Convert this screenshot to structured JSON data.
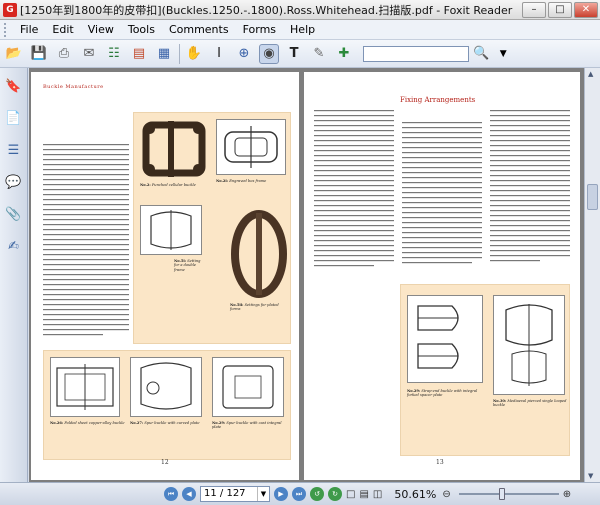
{
  "window": {
    "title": "[1250年到1800年的皮带扣](Buckles.1250.-.1800).Ross.Whitehead.扫描版.pdf - Foxit Reader",
    "controls": [
      "minimize",
      "maximize",
      "close"
    ]
  },
  "menu": {
    "items": [
      "File",
      "Edit",
      "View",
      "Tools",
      "Comments",
      "Forms",
      "Help"
    ]
  },
  "toolbar": {
    "icons": [
      "open-folder-icon",
      "save-icon",
      "print-icon",
      "email-icon",
      "export-icon",
      "scan-icon",
      "snapshot-icon",
      "hand-icon",
      "select-text-icon",
      "zoom-in-icon",
      "snapshot-camera-icon",
      "text-tool-icon",
      "pencil-icon",
      "eraser-icon",
      "search-icon"
    ]
  },
  "left_panel": {
    "icons": [
      "bookmarks-icon",
      "pages-icon",
      "layers-icon",
      "comments-icon",
      "attachments-icon",
      "signatures-icon"
    ]
  },
  "document": {
    "left_page": {
      "running_head": "Buckle Manufacture",
      "page_number": "12",
      "captions": [
        {
          "no": "No.2:",
          "text": "Punched cellular buckle"
        },
        {
          "no": "No.2i:",
          "text": "Engraved box frame"
        },
        {
          "no": "No.5i:",
          "text": "Setting for a double frame"
        },
        {
          "no": "No.5ii:",
          "text": "Settings for plated forms"
        },
        {
          "no": "No.26:",
          "text": "Folded sheet copper-alloy buckle"
        },
        {
          "no": "No.27:",
          "text": "Spur buckle with curved plate"
        },
        {
          "no": "No.29:",
          "text": "Spur buckle with cast integral plate"
        }
      ]
    },
    "right_page": {
      "page_number": "13",
      "section_title": "Fixing Arrangements",
      "captions": [
        {
          "no": "No.29:",
          "text": "Strap-end buckle with integral forked spacer plate"
        },
        {
          "no": "No.30:",
          "text": "Mediaeval pierced single looped buckle"
        }
      ]
    }
  },
  "status": {
    "current_page": "11",
    "total_pages": "127",
    "page_display": "11 / 127",
    "zoom": "50.61%"
  }
}
